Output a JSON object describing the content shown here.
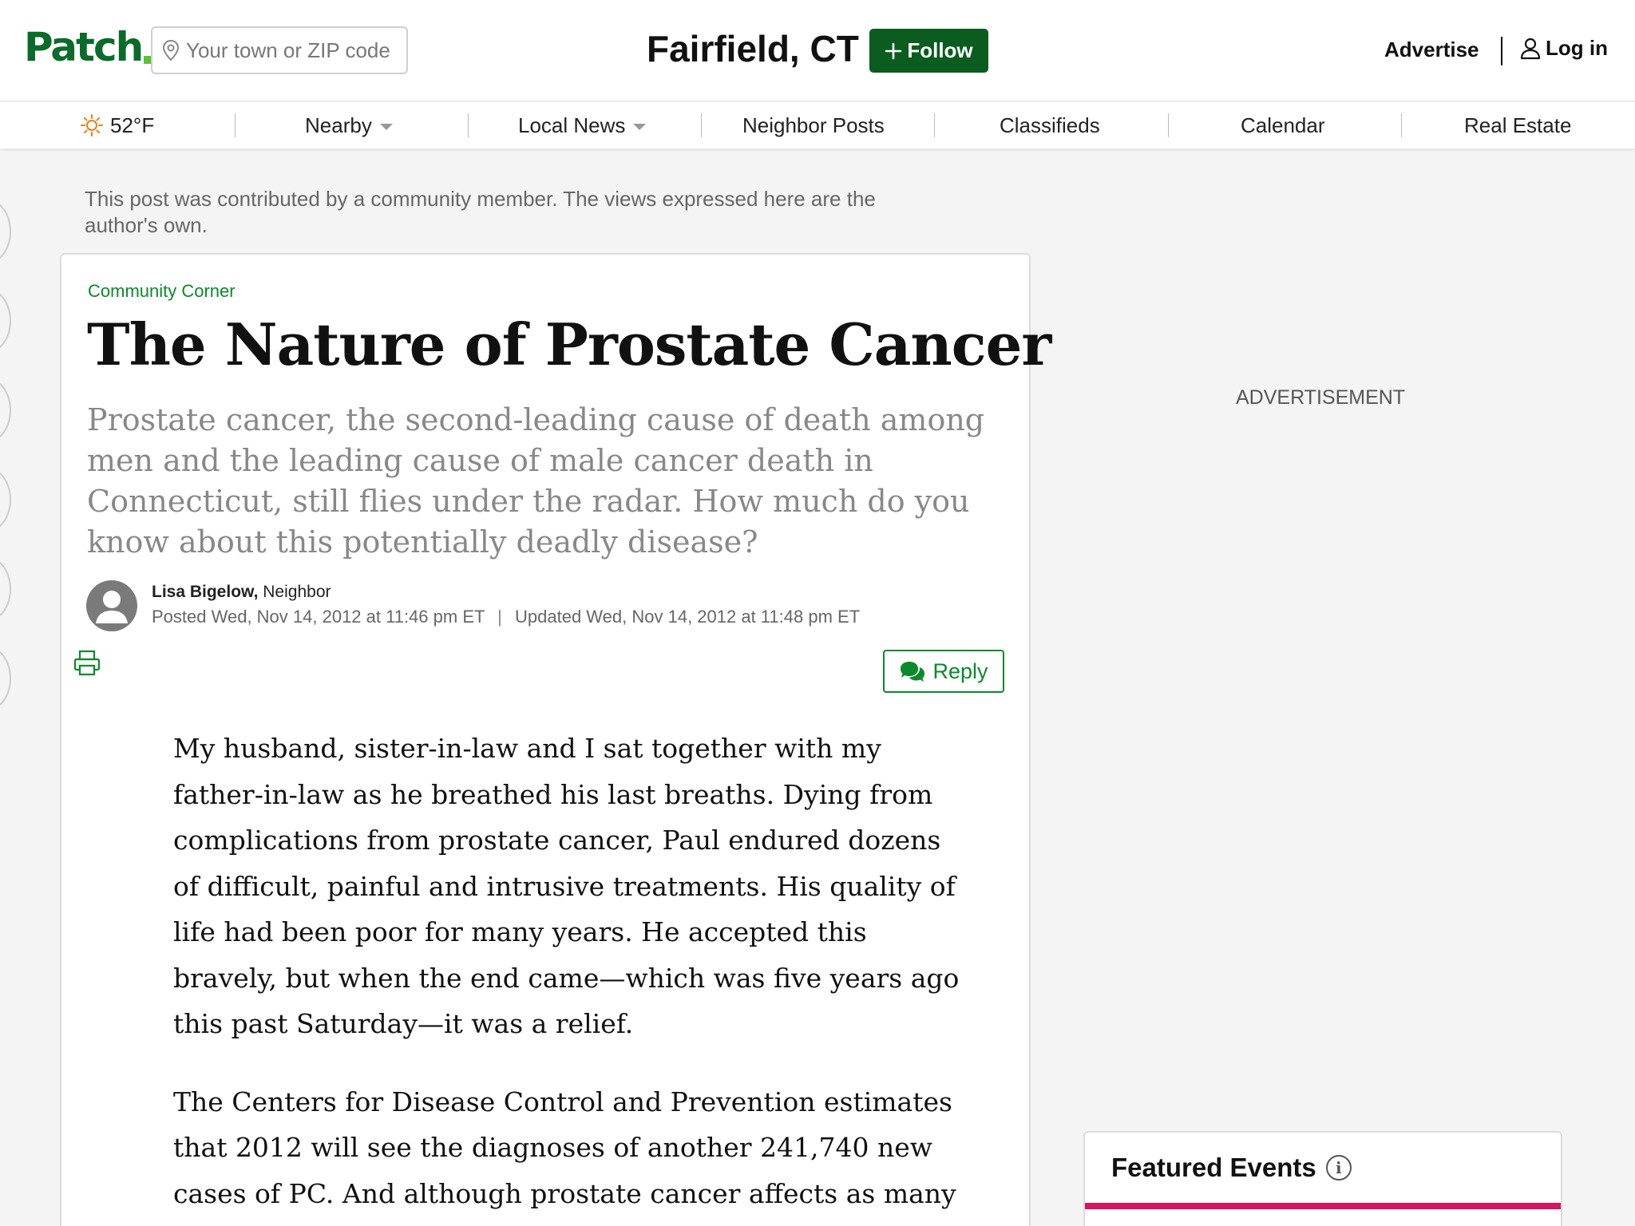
{
  "header": {
    "logo": "Patch",
    "search_placeholder": "Your town or ZIP code",
    "town": "Fairfield, CT",
    "follow_label": "Follow",
    "advertise_label": "Advertise",
    "login_label": "Log in"
  },
  "nav": {
    "weather": "52°F",
    "items": [
      "Nearby",
      "Local News",
      "Neighbor Posts",
      "Classifieds",
      "Calendar",
      "Real Estate"
    ]
  },
  "notice": "This post was contributed by a community member. The views expressed here are the author's own.",
  "article": {
    "category": "Community Corner",
    "title": "The Nature of Prostate Cancer",
    "dek": "Prostate cancer, the second-leading cause of death among men and the leading cause of male cancer death in Connecticut, still flies under the radar. How much do you know about this potentially deadly disease?",
    "author": "Lisa Bigelow,",
    "author_role": "Neighbor",
    "posted": "Posted Wed, Nov 14, 2012 at 11:46 pm ET",
    "updated": "Updated Wed, Nov 14, 2012 at 11:48 pm ET",
    "reply_label": "Reply",
    "paragraphs": [
      "My husband, sister-in-law and I sat together with my father-in-law as he breathed his last breaths. Dying from complications from prostate cancer, Paul endured dozens of difficult, painful and intrusive treatments. His quality of life had been poor for many years. He accepted this bravely, but when the end came—which was five years ago this past Saturday—it was a relief.",
      "The Centers for Disease Control and Prevention estimates that 2012 will see the diagnoses of another 241,740 new cases of PC. And although prostate cancer affects as many"
    ]
  },
  "sidebar": {
    "ad_label": "ADVERTISEMENT",
    "featured_title": "Featured Events"
  },
  "colors": {
    "brand_green": "#0a5c1f",
    "link_green": "#0a8a2a",
    "featured_accent": "#d6145f"
  }
}
